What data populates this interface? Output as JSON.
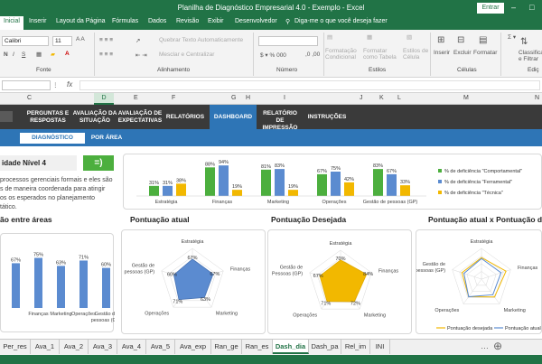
{
  "window": {
    "title": "Planilha de Diagnóstico Empresarial 4.0 - Exemplo - Excel",
    "signin": "Entrar"
  },
  "ribbon_tabs": [
    "Inicial",
    "Inserir",
    "Layout da Página",
    "Fórmulas",
    "Dados",
    "Revisão",
    "Exibir",
    "Desenvolvedor",
    "Diga-me o que você deseja fazer"
  ],
  "ribbon": {
    "font_name": "Calibri",
    "font_size": "11",
    "wrap_text": "Quebrar Texto Automaticamente",
    "merge_center": "Mesclar e Centralizar",
    "cond_format": "Formatação Condicional",
    "format_table": "Formatar como Tabela",
    "cell_styles": "Estilos de Célula",
    "insert": "Inserir",
    "delete": "Excluir",
    "format": "Formatar",
    "sort_filter": "Classificar e Filtrar",
    "groups": {
      "font": "Fonte",
      "alignment": "Alinhamento",
      "number": "Número",
      "styles": "Estilos",
      "cells": "Células",
      "editing": "Ediç"
    }
  },
  "columns": [
    "C",
    "D",
    "E",
    "F",
    "G",
    "H",
    "I",
    "J",
    "K",
    "L",
    "M",
    "N"
  ],
  "nav": [
    "PERGUNTAS E RESPOSTAS",
    "AVALIAÇÃO DA SITUAÇÃO",
    "AVALIAÇÃO DE EXPECTATIVAS",
    "RELATÓRIOS",
    "DASHBOARD",
    "RELATÓRIO DE IMPRESSÃO",
    "INSTRUÇÕES"
  ],
  "subnav": [
    "DIAGNÓSTICO",
    "POR ÁREA"
  ],
  "level": {
    "label": "idade Nível 4",
    "smiley": "=)",
    "description": "processos gerenciais formais e eles são s de maneira coordenada para atingir os os esperados no planejamento tático."
  },
  "chart_data": [
    {
      "type": "bar",
      "categories": [
        "Estratégia",
        "Finanças",
        "Marketing",
        "Operações",
        "Gestão de pessoas (GP)"
      ],
      "series": [
        {
          "name": "% de deficiência \"Comportamental\"",
          "color": "#4caf3e",
          "values": [
            31,
            88,
            81,
            67,
            83
          ]
        },
        {
          "name": "% de deficiência \"Ferramental\"",
          "color": "#5b8bd0",
          "values": [
            31,
            94,
            83,
            75,
            67
          ]
        },
        {
          "name": "% de deficiência \"Técnica\"",
          "color": "#f2b800",
          "values": [
            38,
            19,
            19,
            42,
            33
          ]
        }
      ],
      "label_suffix": "%"
    },
    {
      "type": "bar",
      "title": "ão entre áreas",
      "categories": [
        "",
        "Finanças",
        "Marketing",
        "Operações",
        "Gestão de pessoas (GP)"
      ],
      "values": [
        67,
        75,
        63,
        71,
        60
      ],
      "color": "#5b8bd0",
      "label_suffix": "%"
    },
    {
      "type": "radar",
      "title": "Pontuação atual",
      "categories": [
        "Estratégia",
        "Finanças",
        "Marketing",
        "Operações",
        "Gestão de pessoas (GP)"
      ],
      "values": [
        67,
        67,
        63,
        71,
        60
      ],
      "color": "#5b8bd0",
      "label_suffix": "%"
    },
    {
      "type": "radar",
      "title": "Pontuação Desejada",
      "categories": [
        "Estratégia",
        "Finanças",
        "Marketing",
        "Operações",
        "Gestão de Pessoas (GP)"
      ],
      "values": [
        70,
        84,
        72,
        71,
        67
      ],
      "color": "#f2b800",
      "label_suffix": "%"
    },
    {
      "type": "radar",
      "title": "Pontuação atual x Pontuação dese",
      "categories": [
        "Estratégia",
        "Finanças",
        "Marketing",
        "Operações",
        "Gestão de pessoas (GP)"
      ],
      "series": [
        {
          "name": "Pontuação desejada",
          "color": "#f2b800",
          "values": [
            70,
            84,
            72,
            71,
            67
          ]
        },
        {
          "name": "Pontuação atual",
          "color": "#5b8bd0",
          "values": [
            67,
            67,
            63,
            71,
            60
          ]
        }
      ]
    }
  ],
  "sheet_tabs": [
    "Per_res",
    "Ava_1",
    "Ava_2",
    "Ava_3",
    "Ava_4",
    "Ava_5",
    "Ava_exp",
    "Ran_ge",
    "Ran_es",
    "Dash_dia",
    "Dash_pa",
    "Rel_im",
    "INI"
  ],
  "active_sheet": "Dash_dia",
  "colors": {
    "excel_green": "#217346",
    "nav_dark": "#3a3a3a",
    "nav_blue": "#2e75b6"
  }
}
